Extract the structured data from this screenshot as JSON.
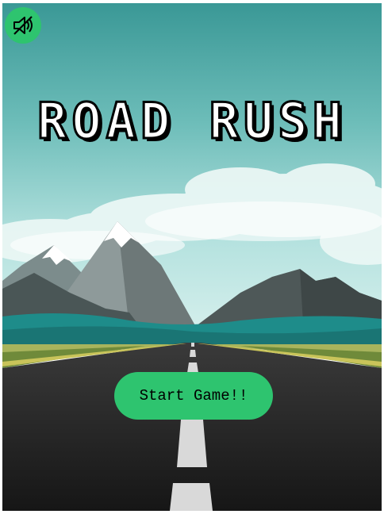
{
  "game": {
    "title": "ROAD RUSH",
    "start_button_label": "Start Game!!",
    "sound_state": "muted"
  },
  "icons": {
    "sound_toggle": "speaker-muted-icon"
  },
  "colors": {
    "accent_green": "#2ec46f",
    "sky_top": "#3d9e9c",
    "sky_bottom": "#b7e3e1",
    "road": "#1f1f1f",
    "grass": "#a3b15a"
  }
}
